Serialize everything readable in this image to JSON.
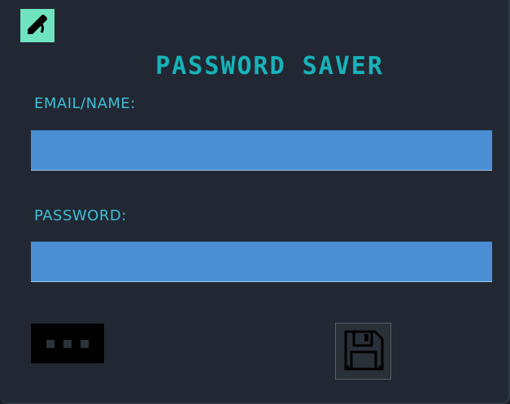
{
  "app": {
    "title": "PASSWORD SAVER"
  },
  "fields": {
    "email_label": "EMAIL/NAME:",
    "email_value": "",
    "password_label": "PASSWORD:",
    "password_value": ""
  },
  "toolbar": {
    "edit_icon": "pencil-icon",
    "more_icon": "more-dots-icon",
    "save_icon": "floppy-disk-icon"
  },
  "colors": {
    "background": "#222833",
    "accent": "#17b3b9",
    "label": "#3cc0d6",
    "input_fill": "#4a8fd4",
    "edit_button": "#6fe3c0"
  }
}
